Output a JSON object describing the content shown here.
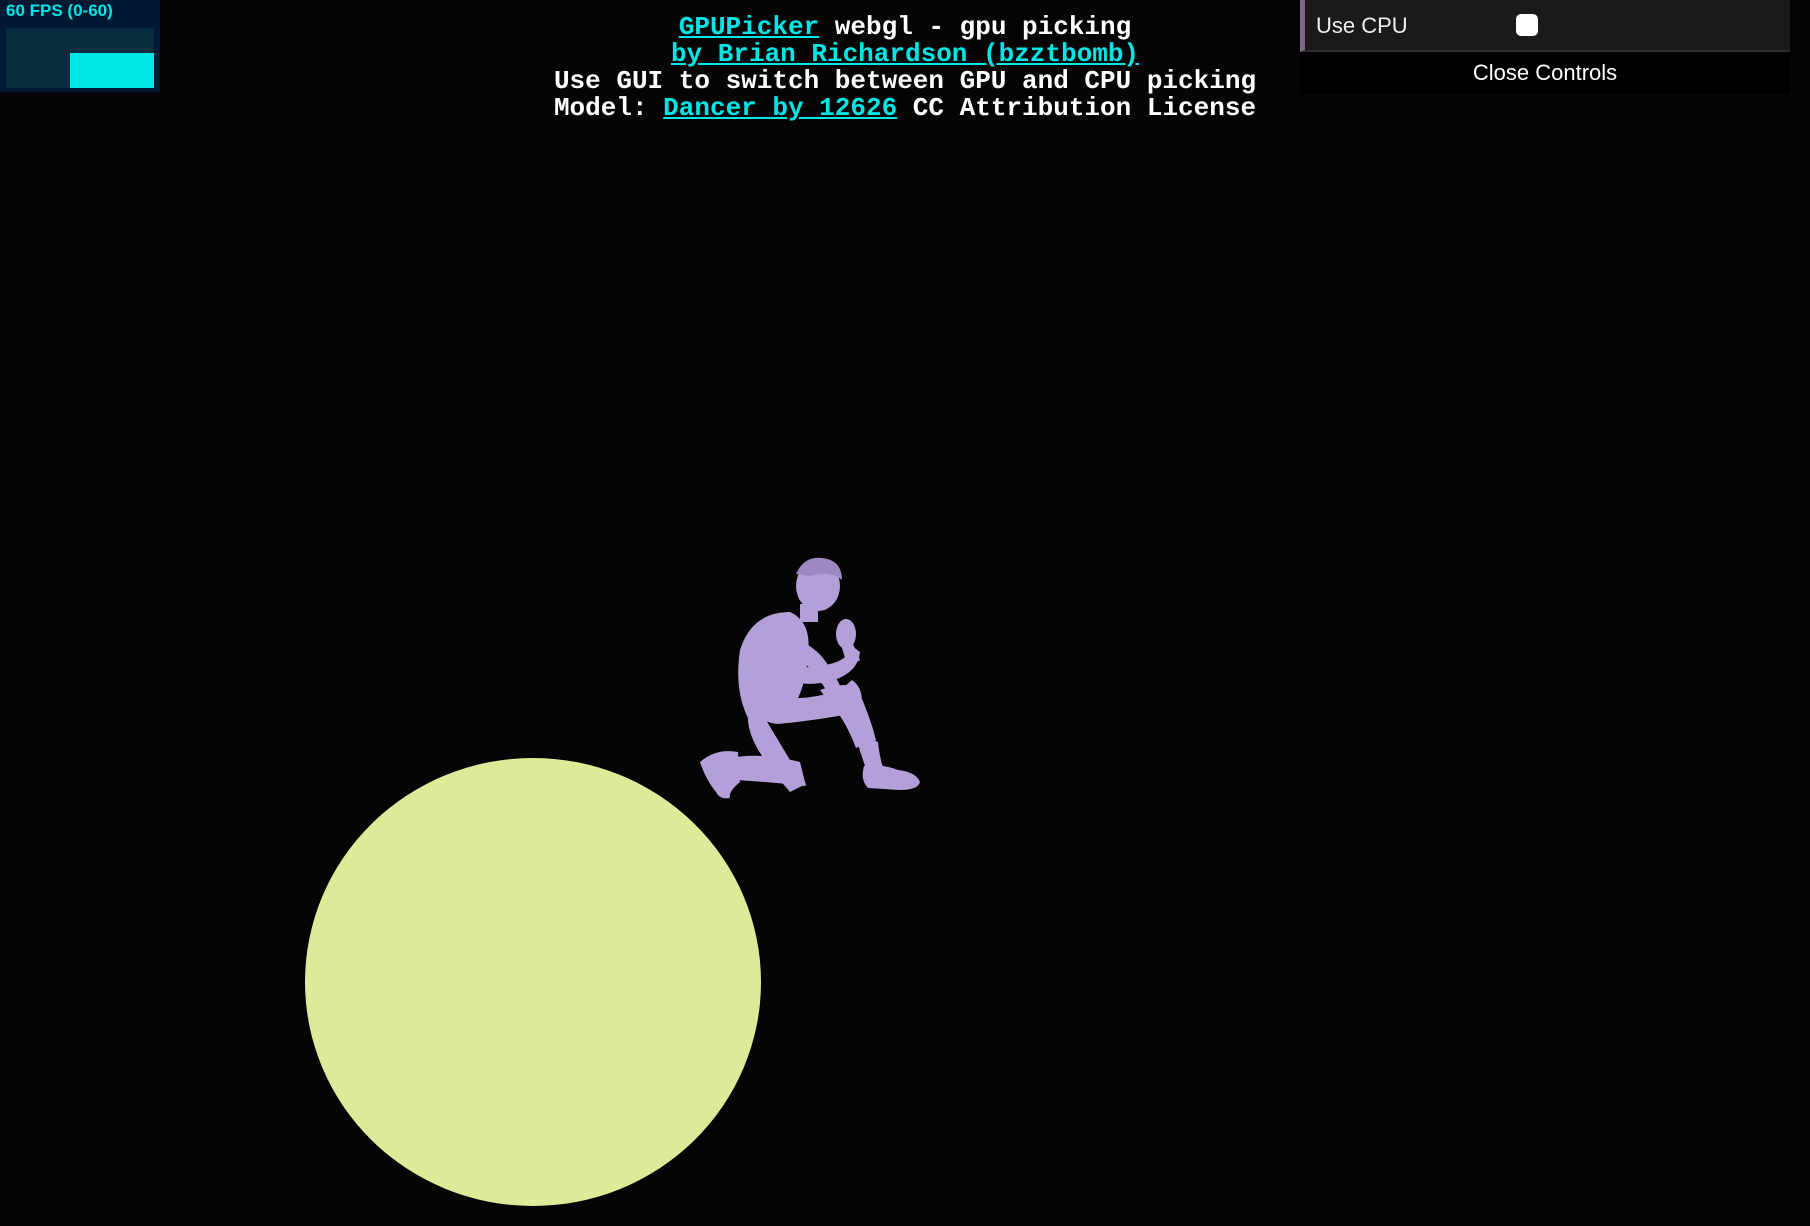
{
  "stats": {
    "fps_label": "60 FPS (0-60)",
    "fps_current": 60,
    "fps_min": 0,
    "fps_max": 60
  },
  "info": {
    "line1_link": "GPUPicker",
    "line1_text": " webgl - gpu picking",
    "line2_link": "by Brian Richardson (bzztbomb)",
    "line3_text": "Use GUI to switch between GPU and CPU picking",
    "line4_prefix": "Model: ",
    "line4_link": "Dancer by 12626",
    "line4_suffix": " CC Attribution License"
  },
  "gui": {
    "use_cpu_label": "Use CPU",
    "use_cpu_checked": false,
    "close_label": "Close Controls"
  },
  "scene": {
    "background_color": "#050505",
    "sphere_color": "#dfea98",
    "model_color": "#b4a0d8",
    "link_color": "#00e5e5",
    "gui_accent_color": "#806787"
  }
}
